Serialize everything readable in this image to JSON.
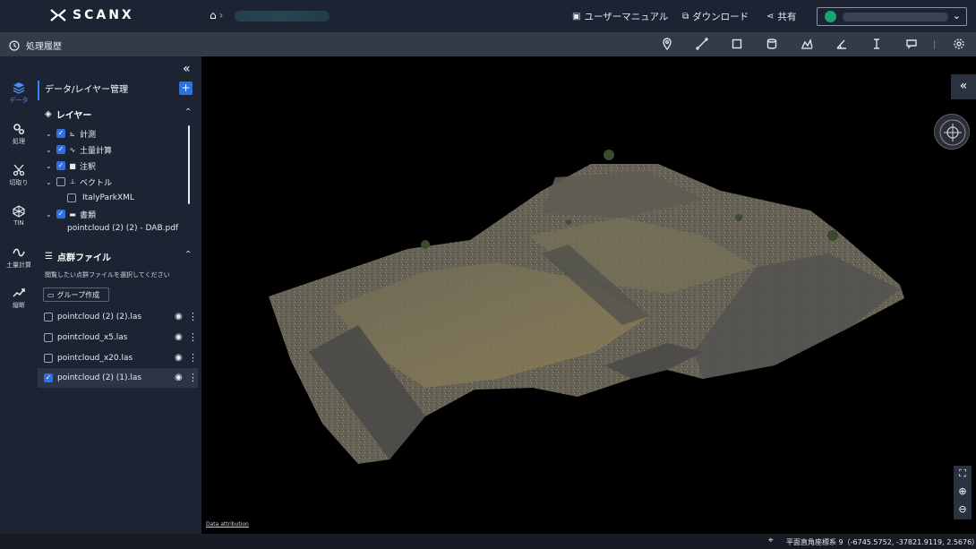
{
  "header": {
    "logo_text": "SCANX",
    "nav_manual": "ユーザーマニュアル",
    "nav_download": "ダウンロード",
    "nav_share": "共有"
  },
  "toolbar": {
    "history_label": "処理履歴",
    "tools": [
      "pin-icon",
      "distance-icon",
      "area-icon",
      "volume-icon",
      "profile-icon",
      "angle-icon",
      "height-icon",
      "comment-icon",
      "settings-icon"
    ]
  },
  "rail": {
    "items": [
      {
        "label": "データ",
        "icon": "layers-icon",
        "active": true
      },
      {
        "label": "処理",
        "icon": "gears-icon",
        "active": false
      },
      {
        "label": "切取り",
        "icon": "scissors-icon",
        "active": false
      },
      {
        "label": "TIN",
        "icon": "tin-icon",
        "active": false
      },
      {
        "label": "土量計算",
        "icon": "earthwork-icon",
        "active": false
      },
      {
        "label": "縦断",
        "icon": "trend-icon",
        "active": false
      }
    ]
  },
  "panel": {
    "title": "データ/レイヤー管理",
    "layers_header": "レイヤー",
    "layers": [
      {
        "label": "計測",
        "checked": true,
        "expanded": true
      },
      {
        "label": "土量計算",
        "checked": true,
        "expanded": true
      },
      {
        "label": "注釈",
        "checked": true,
        "expanded": true
      },
      {
        "label": "ベクトル",
        "checked": false,
        "expanded": true
      },
      {
        "label": "ItalyParkXML",
        "checked": false,
        "child": true
      },
      {
        "label": "書類",
        "checked": true,
        "expanded": true
      },
      {
        "label": "pointcloud (2) (2) - DAB.pdf",
        "child": true
      }
    ],
    "pointcloud_header": "点群ファイル",
    "hint": "閲覧したい点群ファイルを選択してください",
    "group_button": "グループ作成",
    "files": [
      {
        "name": "pointcloud (2) (2).las",
        "checked": false,
        "selected": false
      },
      {
        "name": "pointcloud_x5.las",
        "checked": false,
        "selected": false
      },
      {
        "name": "pointcloud_x20.las",
        "checked": false,
        "selected": false
      },
      {
        "name": "pointcloud (2) (1).las",
        "checked": true,
        "selected": true
      }
    ]
  },
  "viewer": {
    "attribution": "Data attribution"
  },
  "status": {
    "coords": "平面直角座標系 9（-6745.5752, -37821.9119, 2.5676）"
  },
  "colors": {
    "topbar": "#1c2434",
    "toolbar": "#333b48",
    "accent": "#2f6fe0"
  }
}
